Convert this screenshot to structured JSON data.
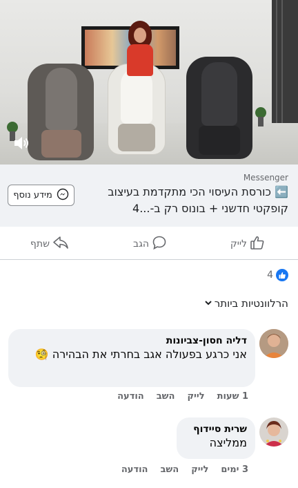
{
  "video": {
    "colors": {
      "wall": "#e2e2e0",
      "floor": "#cbcbc6",
      "chair_left": "#6e6a66",
      "chair_middle": "#ecebe6",
      "chair_right": "#2b2b2d",
      "shirt": "#d93a2a"
    },
    "mute_icon": "speaker-icon"
  },
  "link_preview": {
    "source": "Messenger",
    "title": "⬅️ כורסת העיסוי הכי מתקדמת בעיצוב קופקטי חדשני + בונוס רק ב-...4",
    "more_info_label": "מידע נוסף",
    "more_info_icon": "messenger-icon"
  },
  "actions": {
    "like_label": "לייק",
    "comment_label": "הגב",
    "share_label": "שתף"
  },
  "reactions": {
    "count": "4",
    "icon": "like-badge-icon",
    "color": "#1877f2"
  },
  "sort": {
    "label": "הרלוונטיות ביותר",
    "icon": "chevron-down-icon"
  },
  "comments": [
    {
      "author": "דליה חסון-צביונות",
      "text": "אני כרגע בפעולה אגב בחרתי את הבהירה 🧐",
      "time": "1 שעות",
      "like": "לייק",
      "reply": "השב",
      "message": "הודעה"
    },
    {
      "author": "שרית סיידוף",
      "text": "ממליצה",
      "time": "3 ימים",
      "like": "לייק",
      "reply": "השב",
      "message": "הודעה"
    }
  ]
}
